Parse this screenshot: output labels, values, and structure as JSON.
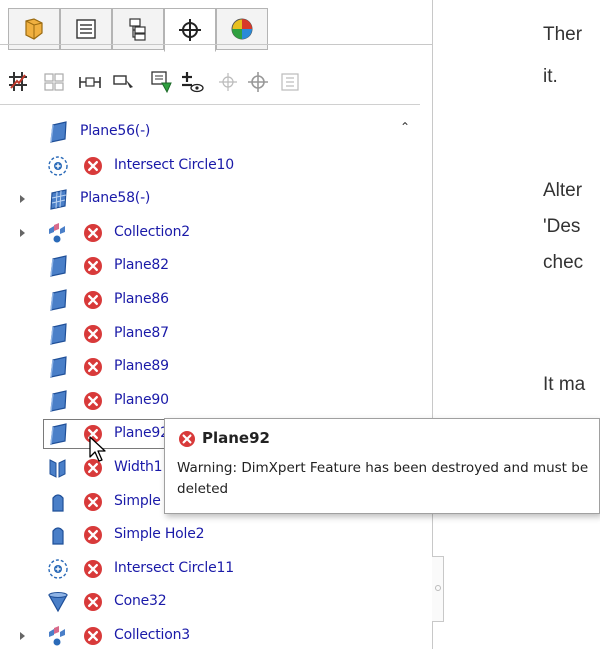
{
  "tabs": [
    {
      "icon": "featuremanager-icon"
    },
    {
      "icon": "propertymanager-icon"
    },
    {
      "icon": "configurationmanager-icon"
    },
    {
      "icon": "dimxpert-manager-icon",
      "active": true
    },
    {
      "icon": "display-manager-icon"
    }
  ],
  "toolbar": [
    {
      "icon": "auto-dimension-scheme-icon"
    },
    {
      "icon": "auto-pair-tolerance-icon"
    },
    {
      "icon": "basic-location-dimension-icon"
    },
    {
      "icon": "basic-size-dimension-icon"
    },
    {
      "icon": "datum-icon"
    },
    {
      "icon": "show-tolerance-status-icon"
    },
    {
      "icon": "copy-scheme-icon"
    },
    {
      "icon": "tts-import-icon"
    },
    {
      "icon": "delete-all-tolerances-icon"
    }
  ],
  "tree": [
    {
      "label": "Plane56(-)",
      "icon": "plane-icon",
      "error": false,
      "expandable": false
    },
    {
      "label": "Intersect Circle10",
      "icon": "intersect-circle-icon",
      "error": true,
      "expandable": false
    },
    {
      "label": "Plane58(-)",
      "icon": "plane-pattern-icon",
      "error": false,
      "expandable": true
    },
    {
      "label": "Collection2",
      "icon": "collection-icon",
      "error": true,
      "expandable": true
    },
    {
      "label": "Plane82",
      "icon": "plane-icon",
      "error": true,
      "expandable": false
    },
    {
      "label": "Plane86",
      "icon": "plane-icon",
      "error": true,
      "expandable": false
    },
    {
      "label": "Plane87",
      "icon": "plane-icon",
      "error": true,
      "expandable": false
    },
    {
      "label": "Plane89",
      "icon": "plane-icon",
      "error": true,
      "expandable": false
    },
    {
      "label": "Plane90",
      "icon": "plane-icon",
      "error": true,
      "expandable": false
    },
    {
      "label": "Plane92",
      "icon": "plane-icon",
      "error": true,
      "expandable": false,
      "selected": true
    },
    {
      "label": "Width1",
      "icon": "width-icon",
      "error": true,
      "expandable": false
    },
    {
      "label": "Simple Hole1",
      "icon": "simple-hole-icon",
      "error": true,
      "expandable": false
    },
    {
      "label": "Simple Hole2",
      "icon": "simple-hole-icon",
      "error": true,
      "expandable": false
    },
    {
      "label": "Intersect Circle11",
      "icon": "intersect-circle-icon",
      "error": true,
      "expandable": false
    },
    {
      "label": "Cone32",
      "icon": "cone-icon",
      "error": true,
      "expandable": false
    },
    {
      "label": "Collection3",
      "icon": "collection-icon",
      "error": true,
      "expandable": true
    }
  ],
  "tooltip": {
    "title": "Plane92",
    "message": "Warning: DimXpert Feature has been destroyed and must be deleted"
  },
  "right_text": {
    "line1": "Ther",
    "line2": "it.",
    "line3": "Alter",
    "line4": "'Des",
    "line5": "chec",
    "line6": "It ma"
  },
  "colors": {
    "link_text": "#1a1aa8",
    "error_red": "#d83a3a",
    "plane_blue": "#3a6fb8"
  }
}
